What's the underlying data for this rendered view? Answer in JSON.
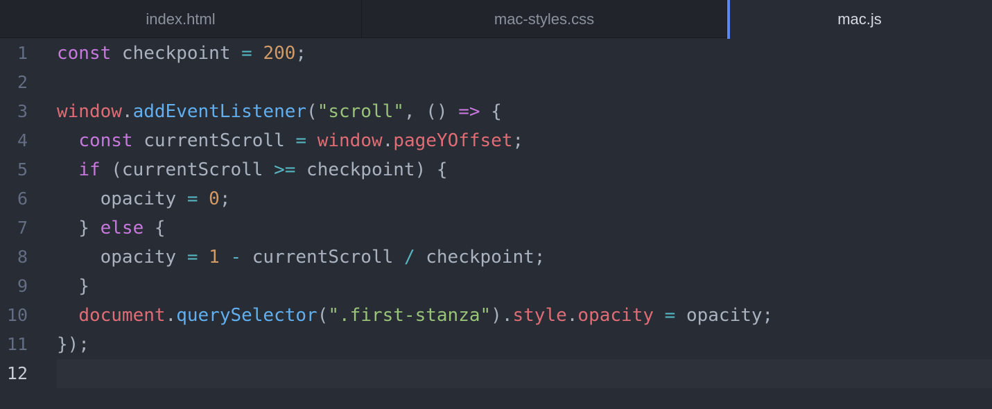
{
  "tabs": [
    {
      "label": "index.html",
      "active": false
    },
    {
      "label": "mac-styles.css",
      "active": false
    },
    {
      "label": "mac.js",
      "active": true
    }
  ],
  "editor": {
    "cursor_line": 12,
    "lines": [
      {
        "number": "1",
        "tokens": [
          {
            "t": "const",
            "c": "kw"
          },
          {
            "t": " checkpoint ",
            "c": "pl"
          },
          {
            "t": "=",
            "c": "op"
          },
          {
            "t": " ",
            "c": "pl"
          },
          {
            "t": "200",
            "c": "num"
          },
          {
            "t": ";",
            "c": "pl"
          }
        ]
      },
      {
        "number": "2",
        "tokens": []
      },
      {
        "number": "3",
        "tokens": [
          {
            "t": "window",
            "c": "var"
          },
          {
            "t": ".",
            "c": "pl"
          },
          {
            "t": "addEventListener",
            "c": "fn"
          },
          {
            "t": "(",
            "c": "pl"
          },
          {
            "t": "\"scroll\"",
            "c": "str"
          },
          {
            "t": ", () ",
            "c": "pl"
          },
          {
            "t": "=>",
            "c": "kw"
          },
          {
            "t": " {",
            "c": "pl"
          }
        ]
      },
      {
        "number": "4",
        "tokens": [
          {
            "t": "  ",
            "c": "pl"
          },
          {
            "t": "const",
            "c": "kw"
          },
          {
            "t": " currentScroll ",
            "c": "pl"
          },
          {
            "t": "=",
            "c": "op"
          },
          {
            "t": " ",
            "c": "pl"
          },
          {
            "t": "window",
            "c": "var"
          },
          {
            "t": ".",
            "c": "pl"
          },
          {
            "t": "pageYOffset",
            "c": "var"
          },
          {
            "t": ";",
            "c": "pl"
          }
        ]
      },
      {
        "number": "5",
        "tokens": [
          {
            "t": "  ",
            "c": "pl"
          },
          {
            "t": "if",
            "c": "kw"
          },
          {
            "t": " (currentScroll ",
            "c": "pl"
          },
          {
            "t": ">=",
            "c": "op"
          },
          {
            "t": " checkpoint) {",
            "c": "pl"
          }
        ]
      },
      {
        "number": "6",
        "tokens": [
          {
            "t": "    opacity ",
            "c": "pl"
          },
          {
            "t": "=",
            "c": "op"
          },
          {
            "t": " ",
            "c": "pl"
          },
          {
            "t": "0",
            "c": "num"
          },
          {
            "t": ";",
            "c": "pl"
          }
        ]
      },
      {
        "number": "7",
        "tokens": [
          {
            "t": "  } ",
            "c": "pl"
          },
          {
            "t": "else",
            "c": "kw"
          },
          {
            "t": " {",
            "c": "pl"
          }
        ]
      },
      {
        "number": "8",
        "tokens": [
          {
            "t": "    opacity ",
            "c": "pl"
          },
          {
            "t": "=",
            "c": "op"
          },
          {
            "t": " ",
            "c": "pl"
          },
          {
            "t": "1",
            "c": "num"
          },
          {
            "t": " ",
            "c": "pl"
          },
          {
            "t": "-",
            "c": "op"
          },
          {
            "t": " currentScroll ",
            "c": "pl"
          },
          {
            "t": "/",
            "c": "op"
          },
          {
            "t": " checkpoint;",
            "c": "pl"
          }
        ]
      },
      {
        "number": "9",
        "tokens": [
          {
            "t": "  }",
            "c": "pl"
          }
        ]
      },
      {
        "number": "10",
        "tokens": [
          {
            "t": "  ",
            "c": "pl"
          },
          {
            "t": "document",
            "c": "var"
          },
          {
            "t": ".",
            "c": "pl"
          },
          {
            "t": "querySelector",
            "c": "fn"
          },
          {
            "t": "(",
            "c": "pl"
          },
          {
            "t": "\".first-stanza\"",
            "c": "str"
          },
          {
            "t": ").",
            "c": "pl"
          },
          {
            "t": "style",
            "c": "var"
          },
          {
            "t": ".",
            "c": "pl"
          },
          {
            "t": "opacity",
            "c": "var"
          },
          {
            "t": " ",
            "c": "pl"
          },
          {
            "t": "=",
            "c": "op"
          },
          {
            "t": " opacity;",
            "c": "pl"
          }
        ]
      },
      {
        "number": "11",
        "tokens": [
          {
            "t": "});",
            "c": "pl"
          }
        ]
      },
      {
        "number": "12",
        "tokens": []
      }
    ]
  }
}
